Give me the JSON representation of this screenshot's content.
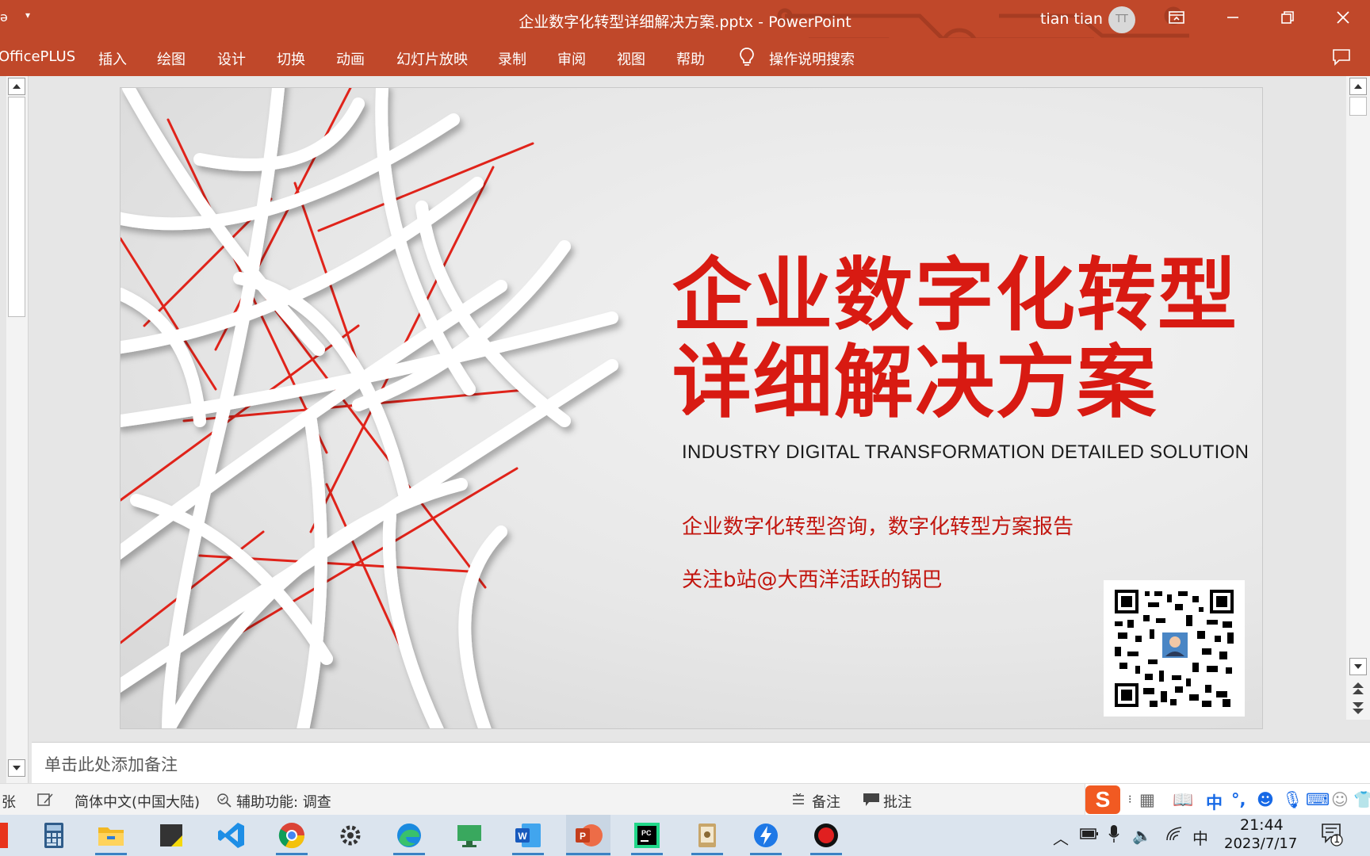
{
  "titlebar": {
    "quick_access_icon": "pin-icon",
    "document_title": "企业数字化转型详细解决方案.pptx  -  PowerPoint",
    "user_name": "tian tian",
    "avatar_initials": "TT",
    "brand_color": "#c0482a"
  },
  "ribbon": {
    "tabs": [
      "OfficePLUS",
      "插入",
      "绘图",
      "设计",
      "切换",
      "动画",
      "幻灯片放映",
      "录制",
      "审阅",
      "视图",
      "帮助"
    ],
    "search_label": "操作说明搜索"
  },
  "slide": {
    "title_line1": "企业数字化转型",
    "title_line2": "详细解决方案",
    "subtitle_en": "INDUSTRY DIGITAL TRANSFORMATION DETAILED SOLUTION",
    "line1": "企业数字化转型咨询，数字化转型方案报告",
    "line2": "关注b站@大西洋活跃的锅巴",
    "title_color": "#d81a12"
  },
  "notes": {
    "placeholder": "单击此处添加备注"
  },
  "statusbar": {
    "slide_counter_fragment": "张",
    "language": "简体中文(中国大陆)",
    "accessibility": "辅助功能: 调查",
    "notes_button": "备注",
    "comments_button": "批注",
    "ime_logo": "S",
    "ime_mode": "中",
    "ime_punct": "°,"
  },
  "taskbar": {
    "time": "21:44",
    "date": "2023/7/17",
    "tray_lang": "中",
    "notification_count": "1",
    "apps": [
      "calculator-icon",
      "file-explorer-icon",
      "sticky-notes-icon",
      "vscode-icon",
      "chrome-icon",
      "settings-icon",
      "edge-icon",
      "remote-desktop-icon",
      "word-icon",
      "powerpoint-icon",
      "pycharm-icon",
      "notes-app-icon",
      "xunlei-icon",
      "obs-icon"
    ]
  }
}
